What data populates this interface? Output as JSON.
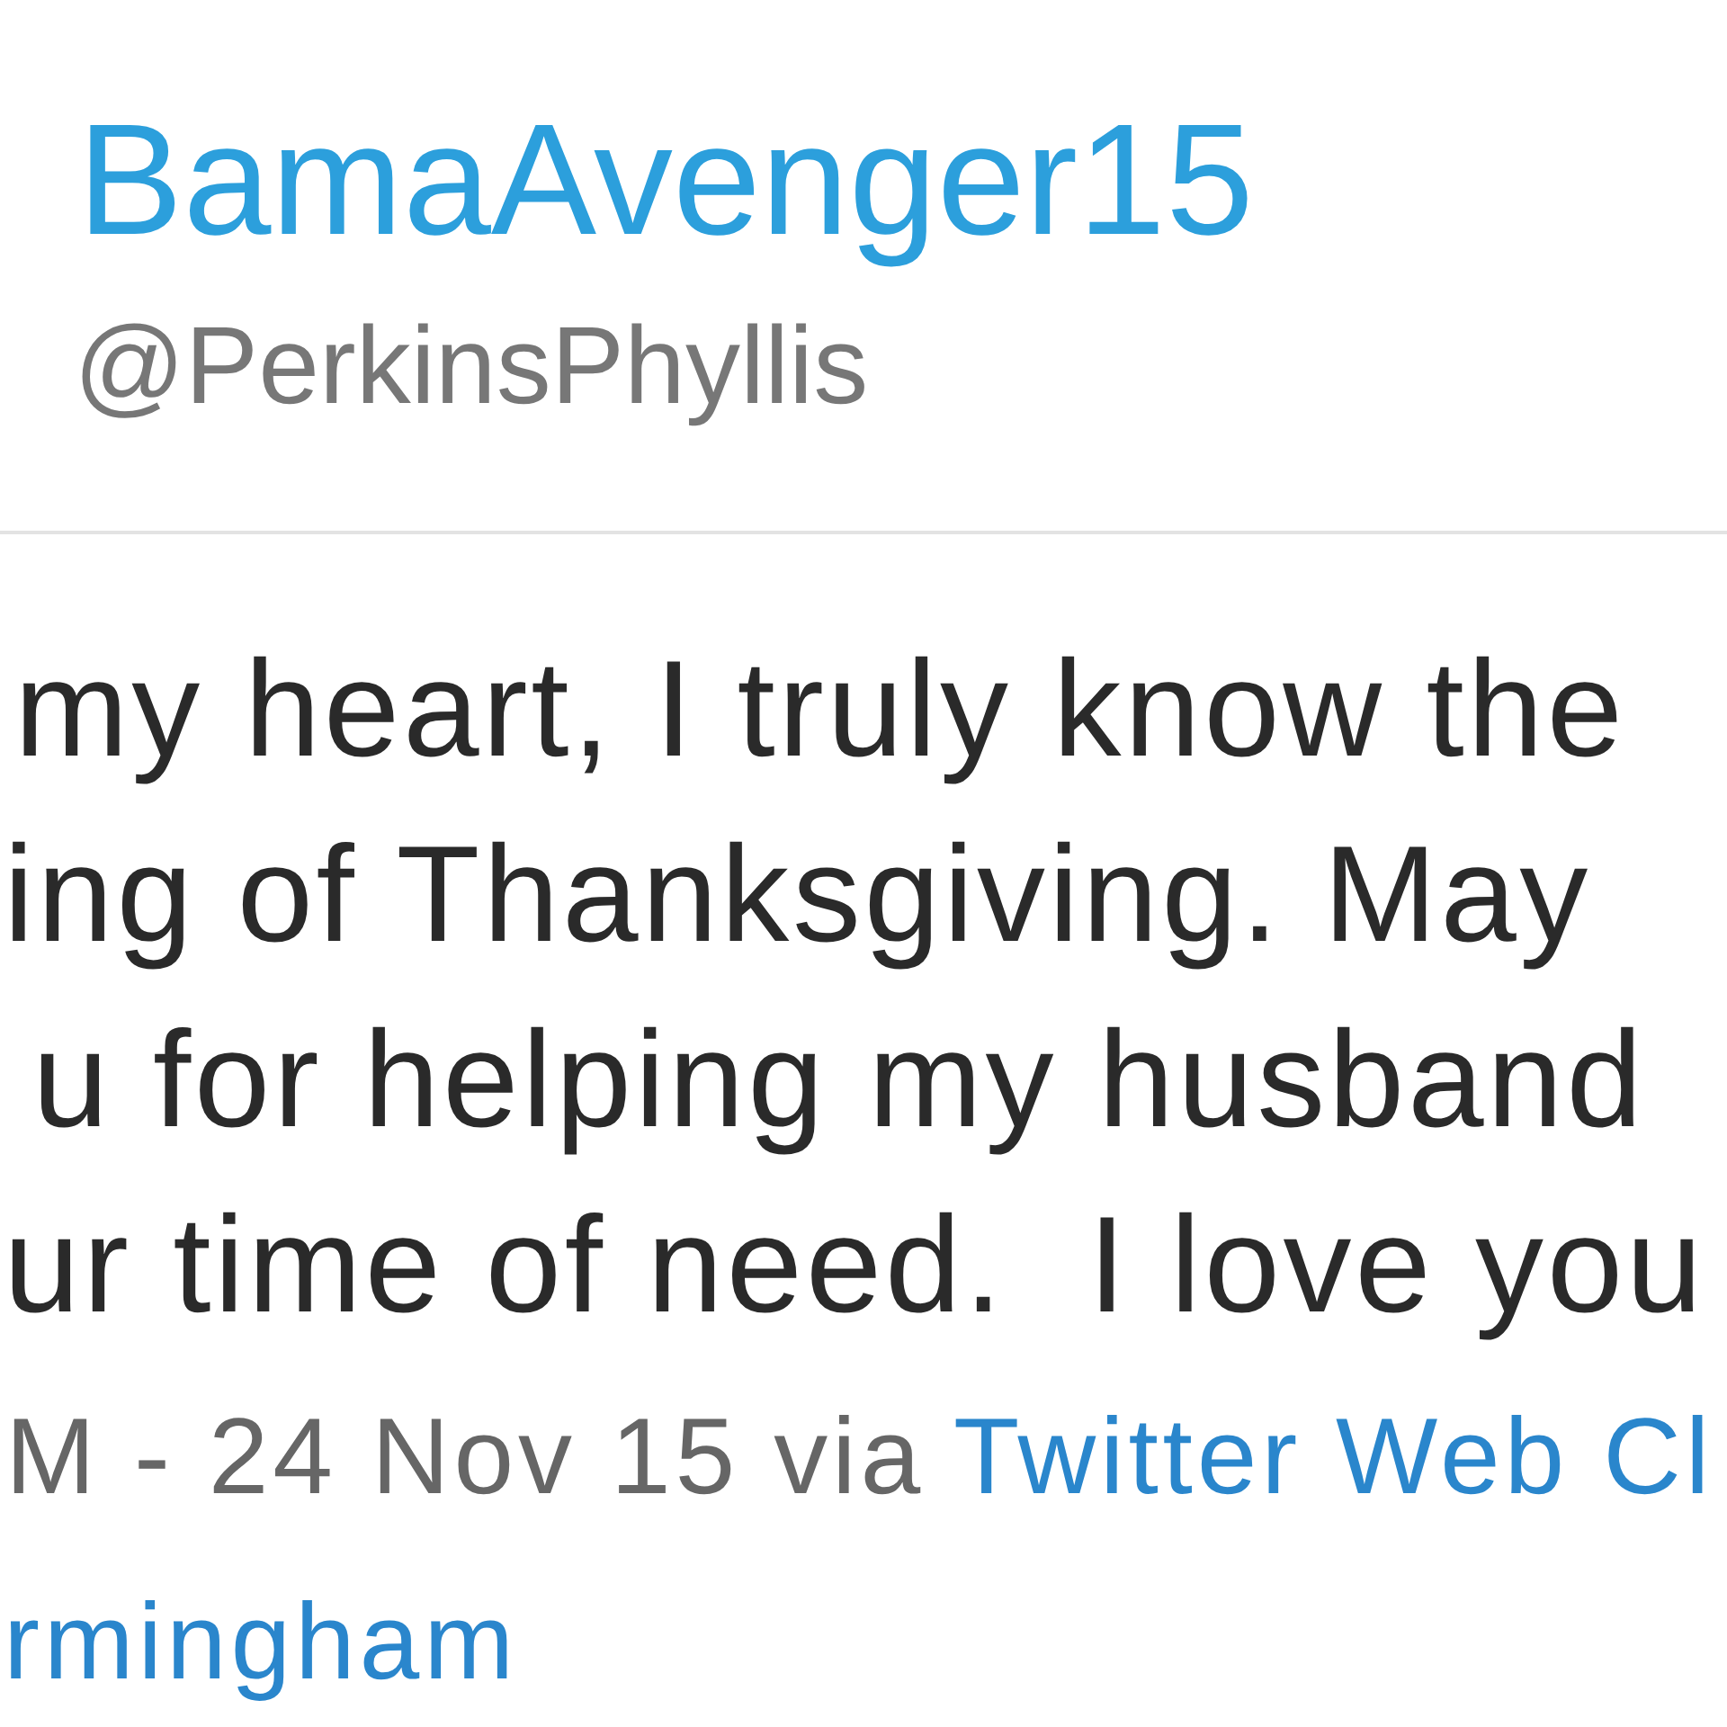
{
  "author": {
    "display_name": "BamaAvenger15",
    "handle": "@PerkinsPhyllis"
  },
  "tweet": {
    "text_lines": [
      "my heart, I truly know the",
      "ing of Thanksgiving. May",
      "u for helping my husband",
      "ur time of need.  I love you"
    ]
  },
  "meta": {
    "timestamp": "M - 24 Nov 15 via",
    "source_link": "Twitter Web Cl"
  },
  "location": "rmingham"
}
